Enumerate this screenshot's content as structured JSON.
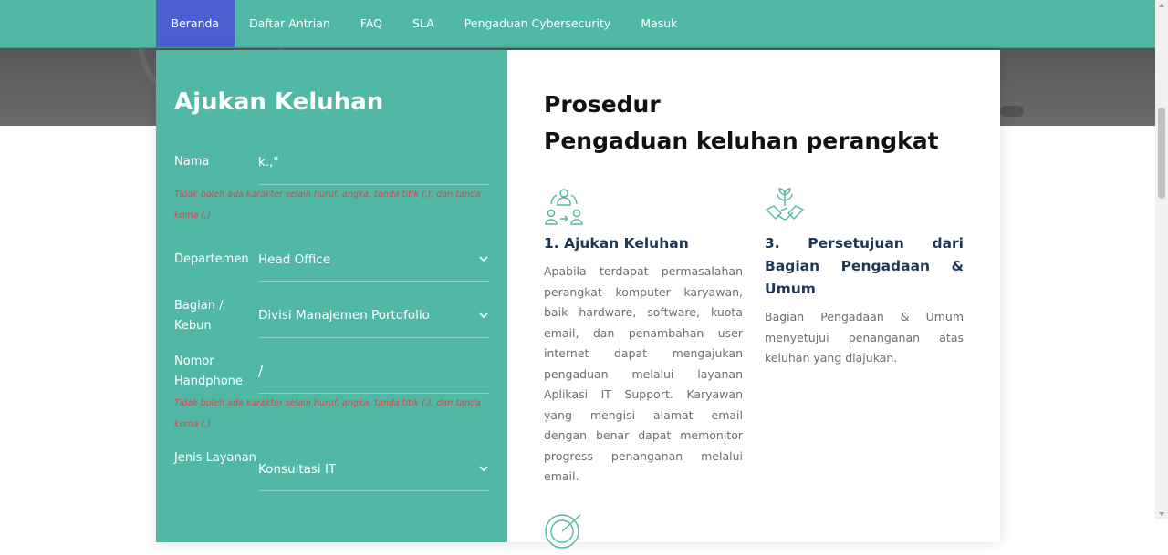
{
  "nav": {
    "items": [
      {
        "label": "Beranda",
        "active": true
      },
      {
        "label": "Daftar Antrian",
        "active": false
      },
      {
        "label": "FAQ",
        "active": false
      },
      {
        "label": "SLA",
        "active": false
      },
      {
        "label": "Pengaduan Cybersecurity",
        "active": false
      },
      {
        "label": "Masuk",
        "active": false
      }
    ]
  },
  "colors": {
    "teal": "#52b8a6",
    "nav_active": "#4b5fd1",
    "error": "#d9444a",
    "heading_dark": "#1e3754"
  },
  "form": {
    "title": "Ajukan Keluhan",
    "nama": {
      "label": "Nama",
      "value": "k.,\""
    },
    "nama_error": "Tidak boleh ada karakter selain huruf, angka, tanda titik (.), dan tanda koma (,)",
    "departemen": {
      "label": "Departemen",
      "value": "Head Office"
    },
    "bagian": {
      "label": "Bagian / Kebun",
      "value": "Divisi Manajemen Portofolio"
    },
    "nomor": {
      "label": "Nomor Handphone",
      "value": "/"
    },
    "nomor_error": "Tidak boleh ada karakter selain huruf, angka, tanda titik (.), dan tanda koma (,)",
    "jenis": {
      "label": "Jenis Layanan",
      "value": "Konsultasi IT"
    }
  },
  "procedure": {
    "title_line1": "Prosedur",
    "title_line2": "Pengaduan keluhan perangkat",
    "step1": {
      "icon": "people-exchange-icon",
      "title": "1. Ajukan Keluhan",
      "desc": "Apabila terdapat permasalahan perangkat komputer karyawan, baik hardware, software, kuota email, dan penambahan user internet dapat mengajukan pengaduan melalui layanan Aplikasi IT Support. Karyawan yang mengisi alamat email dengan benar dapat memonitor progress penanganan melalui email."
    },
    "step3": {
      "icon": "handshake-plant-icon",
      "title": "3. Persetujuan dari Bagian Pengadaan & Umum",
      "desc": "Bagian Pengadaan & Umum menyetujui penanganan atas keluhan yang diajukan."
    }
  }
}
